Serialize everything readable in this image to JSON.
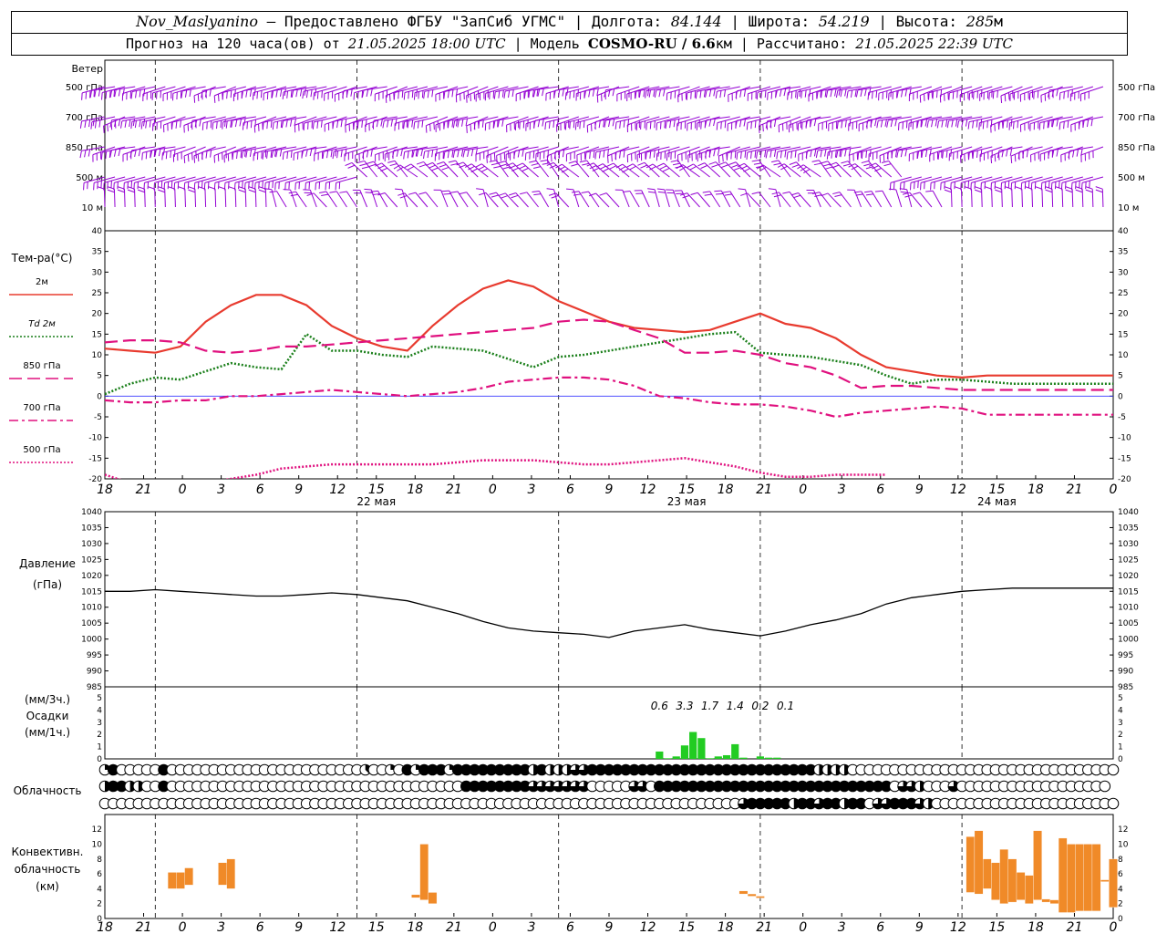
{
  "header": {
    "station": "Nov_Maslyanino",
    "provider": "– Предоставлено ФГБУ \"ЗапСиб УГМС\"",
    "lon_label": "Долгота:",
    "lon": "84.144",
    "lat_label": "Широта:",
    "lat": "54.219",
    "alt_label": "Высота:",
    "alt": "285",
    "alt_unit": "м",
    "forecast_prefix": "Прогноз на 120 часа(ов) от",
    "forecast_time": "21.05.2025 18:00 UTC",
    "model_label": "Модель",
    "model": "COSMO-RU / 6.6",
    "model_unit": "км",
    "calc_label": "Рассчитано:",
    "calc_time": "21.05.2025 22:39 UTC"
  },
  "time_axis": {
    "hour_labels": [
      "18",
      "21",
      "0",
      "3",
      "6",
      "9",
      "12",
      "15",
      "18",
      "21",
      "0",
      "3",
      "6",
      "9",
      "12",
      "15",
      "18",
      "21",
      "0",
      "3",
      "6",
      "9",
      "12",
      "15",
      "18",
      "21",
      "0"
    ],
    "date_labels": [
      {
        "index": 7,
        "text": "22 мая"
      },
      {
        "index": 15,
        "text": "23 мая"
      },
      {
        "index": 23,
        "text": "24 мая"
      }
    ]
  },
  "wind_panel": {
    "title": "Ветер",
    "levels": [
      "500 гПа",
      "700 гПа",
      "850 гПа",
      "500 м",
      "10 м"
    ],
    "color": "#9400d3"
  },
  "temperature_panel": {
    "title": "Тем-ра(°C)",
    "legend": [
      {
        "label": "2м",
        "color": "#e83b2f",
        "style": "solid"
      },
      {
        "label": "Td 2м",
        "color": "#1a7f1a",
        "style": "dotted"
      },
      {
        "label": "850 гПа",
        "color": "#e0117f",
        "style": "longdash"
      },
      {
        "label": "700 гПа",
        "color": "#e0117f",
        "style": "dashdot"
      },
      {
        "label": "500 гПа",
        "color": "#e0117f",
        "style": "dotted"
      }
    ],
    "y_ticks": [
      40,
      35,
      30,
      25,
      20,
      15,
      10,
      5,
      0,
      -5,
      -10,
      -15,
      -20
    ]
  },
  "pressure_panel": {
    "title": "Давление",
    "unit": "(гПа)",
    "y_ticks": [
      1040,
      1035,
      1030,
      1025,
      1020,
      1015,
      1010,
      1005,
      1000,
      995,
      990,
      985
    ]
  },
  "precip_panel": {
    "unit3": "(мм/3ч.)",
    "title": "Осадки",
    "unit1": "(мм/1ч.)",
    "y_ticks": [
      5,
      4,
      3,
      2,
      1,
      0
    ],
    "color": "#22cc22",
    "totals": [
      {
        "t": 66,
        "text": "0.6"
      },
      {
        "t": 69,
        "text": "3.3"
      },
      {
        "t": 72,
        "text": "1.7"
      },
      {
        "t": 75,
        "text": "1.4"
      },
      {
        "t": 78,
        "text": "0.2"
      },
      {
        "t": 81,
        "text": "0.1"
      }
    ]
  },
  "cloud_panel": {
    "title": "Облачность"
  },
  "convective_panel": {
    "title1": "Конвективн.",
    "title2": "облачность",
    "unit": "(км)",
    "y_ticks": [
      12,
      10,
      8,
      6,
      4,
      2,
      0
    ],
    "color": "#f08a28"
  },
  "chart_data": {
    "type": "line",
    "x_unit": "hours since 21.05.2025 18:00 UTC",
    "temperature": {
      "ylim": [
        -20,
        40
      ],
      "series": [
        {
          "name": "2м",
          "x": [
            0,
            3,
            6,
            9,
            12,
            15,
            18,
            21,
            24,
            27,
            30,
            33,
            36,
            39,
            42,
            45,
            48,
            51,
            54,
            57,
            60,
            63,
            66,
            69,
            72,
            75,
            78,
            81,
            84,
            87,
            90,
            93,
            96,
            99,
            102,
            105,
            108,
            111,
            114,
            117,
            120
          ],
          "values": [
            11.5,
            11,
            10.5,
            12,
            18,
            22,
            24.5,
            24.5,
            22,
            17,
            14,
            12,
            11,
            17,
            22,
            26,
            28,
            26.5,
            23,
            20.5,
            18,
            16.5,
            16,
            15.5,
            16,
            18,
            20,
            17.5,
            16.5,
            14,
            10,
            7,
            6,
            5,
            4.5,
            5,
            5,
            5,
            5,
            5,
            5
          ]
        },
        {
          "name": "Td 2м",
          "x": [
            0,
            3,
            6,
            9,
            12,
            15,
            18,
            21,
            24,
            27,
            30,
            33,
            36,
            39,
            42,
            45,
            48,
            51,
            54,
            57,
            60,
            63,
            66,
            69,
            72,
            75,
            78,
            81,
            84,
            87,
            90,
            93,
            96,
            99,
            102,
            105,
            108,
            111,
            114,
            117,
            120
          ],
          "values": [
            0.5,
            3,
            4.5,
            4,
            6,
            8,
            7,
            6.5,
            15,
            11,
            11,
            10,
            9.5,
            12,
            11.5,
            11,
            9,
            7,
            9.5,
            10,
            11,
            12,
            13,
            14,
            15,
            15.5,
            10.5,
            10,
            9.5,
            8.5,
            7.5,
            5,
            3,
            4,
            4,
            3.5,
            3,
            3,
            3,
            3,
            3
          ]
        },
        {
          "name": "850 гПа",
          "x": [
            0,
            3,
            6,
            9,
            12,
            15,
            18,
            21,
            24,
            27,
            30,
            33,
            36,
            39,
            42,
            45,
            48,
            51,
            54,
            57,
            60,
            63,
            66,
            69,
            72,
            75,
            78,
            81,
            84,
            87,
            90,
            93,
            96,
            99,
            102,
            105,
            108,
            111,
            114,
            117,
            120
          ],
          "values": [
            13,
            13.5,
            13.5,
            13,
            11,
            10.5,
            11,
            12,
            12,
            12.5,
            13,
            13.5,
            14,
            14.5,
            15,
            15.5,
            16,
            16.5,
            18,
            18.5,
            18,
            16,
            14,
            10.5,
            10.5,
            11,
            10,
            8,
            7,
            5,
            2,
            2.5,
            2.5,
            2,
            1.5,
            1.5,
            1.5,
            1.5,
            1.5,
            1.5,
            1.5
          ]
        },
        {
          "name": "700 гПа",
          "x": [
            0,
            3,
            6,
            9,
            12,
            15,
            18,
            21,
            24,
            27,
            30,
            33,
            36,
            39,
            42,
            45,
            48,
            51,
            54,
            57,
            60,
            63,
            66,
            69,
            72,
            75,
            78,
            81,
            84,
            87,
            90,
            93,
            96,
            99,
            102,
            105,
            108,
            111,
            114,
            117,
            120
          ],
          "values": [
            -1,
            -1.5,
            -1.5,
            -1,
            -1,
            0,
            0,
            0.5,
            1,
            1.5,
            1,
            0.5,
            0,
            0.5,
            1,
            2,
            3.5,
            4,
            4.5,
            4.5,
            4,
            2.5,
            0,
            -0.5,
            -1.5,
            -2,
            -2,
            -2.5,
            -3.5,
            -5,
            -4,
            -3.5,
            -3,
            -2.5,
            -3,
            -4.5,
            -4.5,
            -4.5,
            -4.5,
            -4.5,
            -4.5
          ]
        },
        {
          "name": "500 гПа",
          "x": [
            0,
            3,
            6,
            9,
            12,
            15,
            18,
            21,
            24,
            27,
            30,
            33,
            36,
            39,
            42,
            45,
            48,
            51,
            54,
            57,
            60,
            63,
            66,
            69,
            72,
            75,
            78,
            81,
            84,
            87,
            90,
            93
          ],
          "values": [
            -19,
            -21,
            -22,
            -22,
            -21,
            -20,
            -19,
            -17.5,
            -17,
            -16.5,
            -16.5,
            -16.5,
            -16.5,
            -16.5,
            -16,
            -15.5,
            -15.5,
            -15.5,
            -16,
            -16.5,
            -16.5,
            -16,
            -15.5,
            -15,
            -16,
            -17,
            -18.5,
            -19.5,
            -19.5,
            -19,
            -19,
            -19
          ]
        }
      ]
    },
    "pressure": {
      "ylim": [
        985,
        1040
      ],
      "x": [
        0,
        3,
        6,
        9,
        12,
        15,
        18,
        21,
        24,
        27,
        30,
        33,
        36,
        39,
        42,
        45,
        48,
        51,
        54,
        57,
        60,
        63,
        66,
        69,
        72,
        75,
        78,
        81,
        84,
        87,
        90,
        93,
        96,
        99,
        102,
        105,
        108,
        111,
        114,
        117,
        120
      ],
      "values": [
        1015,
        1015,
        1015.5,
        1015,
        1014.5,
        1014,
        1013.5,
        1013.5,
        1014,
        1014.5,
        1014,
        1013,
        1012,
        1010,
        1008,
        1005.5,
        1003.5,
        1002.5,
        1002,
        1001.5,
        1000.5,
        1002.5,
        1003.5,
        1004.5,
        1003,
        1002,
        1001,
        1002.5,
        1004.5,
        1006,
        1008,
        1011,
        1013,
        1014,
        1015,
        1015.5,
        1016,
        1016,
        1016,
        1016,
        1016
      ]
    },
    "precipitation": {
      "unit": "mm/1h",
      "ylim": [
        0,
        5
      ],
      "x": [
        66,
        67,
        68,
        69,
        70,
        71,
        72,
        73,
        74,
        75,
        76,
        77,
        78,
        79,
        80
      ],
      "values": [
        0.6,
        0.05,
        0.2,
        1.1,
        2.2,
        1.7,
        0.05,
        0.2,
        0.3,
        1.2,
        0.1,
        0.0,
        0.2,
        0.1,
        0.1
      ]
    },
    "cloudiness": {
      "layers": [
        "low",
        "middle",
        "high"
      ],
      "values_oktas_per_hour": {
        "low": [
          2,
          8,
          0,
          0,
          0,
          0,
          0,
          8,
          0,
          0,
          0,
          0,
          0,
          0,
          0,
          0,
          0,
          0,
          0,
          0,
          0,
          0,
          0,
          0,
          0,
          0,
          0,
          0,
          0,
          0,
          0,
          3,
          0,
          0,
          2,
          0,
          8,
          2,
          8,
          8,
          8,
          2,
          8,
          8,
          8,
          8,
          8,
          8,
          8,
          8,
          8,
          4,
          8,
          4,
          4,
          4,
          6,
          6,
          8,
          8,
          8,
          8,
          8,
          8,
          8,
          8,
          8,
          8,
          8,
          8,
          8,
          8,
          8,
          8,
          8,
          8,
          8,
          8,
          8,
          8,
          8,
          8,
          8,
          8,
          8,
          4,
          4,
          4,
          4,
          0,
          0,
          0,
          0,
          0,
          0,
          0,
          0,
          0,
          0,
          0,
          0,
          0,
          0,
          0,
          0,
          0,
          0,
          0,
          0,
          0,
          0,
          0,
          0,
          0,
          0,
          0,
          0,
          0,
          0,
          0,
          0
        ],
        "middle": [
          4,
          8,
          8,
          4,
          4,
          0,
          0,
          8,
          0,
          0,
          0,
          0,
          0,
          0,
          0,
          0,
          0,
          0,
          0,
          0,
          0,
          0,
          0,
          0,
          0,
          0,
          0,
          0,
          0,
          0,
          0,
          0,
          0,
          0,
          0,
          0,
          0,
          0,
          0,
          0,
          0,
          0,
          0,
          8,
          8,
          8,
          8,
          8,
          8,
          8,
          8,
          6,
          6,
          6,
          6,
          6,
          6,
          6,
          0,
          0,
          0,
          0,
          0,
          6,
          6,
          0,
          8,
          8,
          8,
          8,
          8,
          8,
          8,
          8,
          8,
          8,
          8,
          8,
          8,
          8,
          8,
          8,
          8,
          8,
          8,
          8,
          8,
          8,
          8,
          8,
          8,
          8,
          8,
          8,
          0,
          6,
          6,
          4,
          0,
          0,
          0,
          6,
          0,
          0,
          0,
          0,
          0,
          0,
          0,
          0,
          0,
          0,
          0,
          0,
          0,
          0,
          0,
          0,
          0,
          0
        ],
        "high": [
          0,
          0,
          0,
          0,
          0,
          0,
          0,
          0,
          0,
          0,
          0,
          0,
          0,
          0,
          0,
          0,
          0,
          0,
          0,
          0,
          0,
          0,
          0,
          0,
          0,
          0,
          0,
          0,
          0,
          0,
          0,
          0,
          0,
          0,
          0,
          0,
          0,
          0,
          0,
          0,
          0,
          0,
          0,
          0,
          0,
          0,
          0,
          0,
          0,
          0,
          0,
          0,
          0,
          0,
          0,
          0,
          0,
          0,
          0,
          0,
          0,
          0,
          0,
          0,
          0,
          0,
          0,
          0,
          0,
          0,
          0,
          0,
          0,
          0,
          0,
          0,
          6,
          8,
          8,
          8,
          8,
          8,
          4,
          8,
          8,
          6,
          8,
          8,
          4,
          8,
          8,
          0,
          6,
          6,
          8,
          8,
          8,
          6,
          4,
          0,
          0,
          0,
          0,
          0,
          0,
          0,
          0,
          0,
          0,
          0,
          0,
          0,
          0,
          0,
          0,
          0,
          0,
          0,
          0,
          0,
          0
        ]
      }
    },
    "convective_cloud": {
      "unit": "km",
      "ylim": [
        0,
        13
      ],
      "layers": [
        {
          "t": 8,
          "base": 4,
          "top": 6.2
        },
        {
          "t": 9,
          "base": 4,
          "top": 6.2
        },
        {
          "t": 10,
          "base": 4.5,
          "top": 6.8
        },
        {
          "t": 14,
          "base": 4.5,
          "top": 7.5
        },
        {
          "t": 15,
          "base": 4,
          "top": 8
        },
        {
          "t": 37,
          "base": 2.8,
          "top": 3.2
        },
        {
          "t": 38,
          "base": 2.5,
          "top": 10
        },
        {
          "t": 39,
          "base": 2,
          "top": 3.5
        },
        {
          "t": 76,
          "base": 3.3,
          "top": 3.3
        },
        {
          "t": 77,
          "base": 3,
          "top": 3.3
        },
        {
          "t": 78,
          "base": 2.8,
          "top": 3
        },
        {
          "t": 103,
          "base": 3.5,
          "top": 11
        },
        {
          "t": 104,
          "base": 3.3,
          "top": 11.8
        },
        {
          "t": 105,
          "base": 4,
          "top": 8
        },
        {
          "t": 106,
          "base": 2.5,
          "top": 7.5
        },
        {
          "t": 107,
          "base": 2,
          "top": 9.3
        },
        {
          "t": 108,
          "base": 2.2,
          "top": 8
        },
        {
          "t": 109,
          "base": 2.5,
          "top": 6.2
        },
        {
          "t": 110,
          "base": 2,
          "top": 5.8
        },
        {
          "t": 111,
          "base": 2.5,
          "top": 11.8
        },
        {
          "t": 112,
          "base": 2.2,
          "top": 2.6
        },
        {
          "t": 113,
          "base": 2,
          "top": 2.5
        },
        {
          "t": 114,
          "base": 0.8,
          "top": 10.8
        },
        {
          "t": 115,
          "base": 0.8,
          "top": 10
        },
        {
          "t": 116,
          "base": 1,
          "top": 10
        },
        {
          "t": 117,
          "base": 1,
          "top": 10
        },
        {
          "t": 118,
          "base": 1,
          "top": 10
        },
        {
          "t": 119,
          "base": 5,
          "top": 5.2
        },
        {
          "t": 120,
          "base": 1.5,
          "top": 8
        }
      ]
    }
  }
}
